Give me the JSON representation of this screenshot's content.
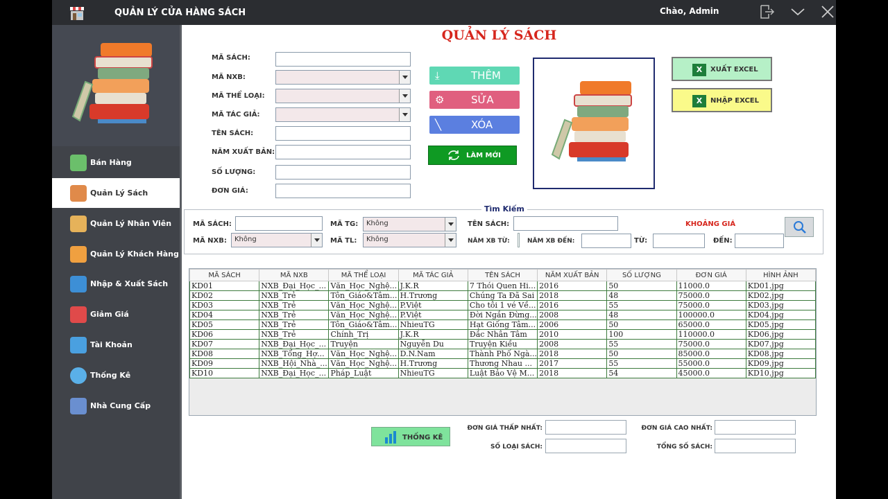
{
  "titlebar": {
    "title": "QUẢN LÝ CỬA HÀNG SÁCH",
    "greeting": "Chào,  Admin"
  },
  "sidebar": {
    "items": [
      {
        "label": "Bán Hàng",
        "icon": "cash-register-icon",
        "color": "#6bbf6b"
      },
      {
        "label": "Quản Lý Sách",
        "icon": "book-icon",
        "color": "#e08a4a"
      },
      {
        "label": "Quản Lý Nhân Viên",
        "icon": "people-icon",
        "color": "#e6b25a"
      },
      {
        "label": "Quản Lý Khách Hàng",
        "icon": "customer-icon",
        "color": "#f0a040"
      },
      {
        "label": "Nhập & Xuất Sách",
        "icon": "transfer-icon",
        "color": "#3d8fd6"
      },
      {
        "label": "Giảm Giá",
        "icon": "sale-icon",
        "color": "#e04a4a"
      },
      {
        "label": "Tài Khoản",
        "icon": "account-icon",
        "color": "#4aa0e0"
      },
      {
        "label": "Thống Kê",
        "icon": "pie-chart-icon",
        "color": "#5ab0e8"
      },
      {
        "label": "Nhà Cung Cấp",
        "icon": "store-icon",
        "color": "#6a8fd0"
      }
    ]
  },
  "heading": "QUẢN LÝ SÁCH",
  "form": {
    "ma_sach": "MÃ SÁCH:",
    "ma_nxb": "MÃ NXB:",
    "ma_the_loai": "MÃ THỂ LOẠI:",
    "ma_tac_gia": "MÃ TÁC GIẢ:",
    "ten_sach": "TÊN SÁCH:",
    "nam_xuat_ban": "NĂM XUẤT BẢN:",
    "so_luong": "SỐ LƯỢNG:",
    "don_gia": "ĐƠN GIÁ:"
  },
  "actions": {
    "them": "THÊM",
    "sua": "SỬA",
    "xoa": "XÓA",
    "lam_moi": "LÀM MỚI",
    "xuat_excel": "XUẤT EXCEL",
    "nhap_excel": "NHẬP EXCEL"
  },
  "search": {
    "title": "Tìm Kiếm",
    "ma_sach": "MÃ SÁCH:",
    "ma_tg": "MÃ TG:",
    "ten_sach": "TÊN SÁCH:",
    "ma_nxb": "MÃ NXB:",
    "ma_tl": "MÃ TL:",
    "nam_xb_tu": "NĂM XB TỪ:",
    "nam_xb_den": "NĂM XB ĐẾN:",
    "tu": "TỪ:",
    "den": "ĐẾN:",
    "khoang_gia": "KHOẢNG GIÁ",
    "ma_tg_value": "Không",
    "ma_nxb_value": "Không",
    "ma_tl_value": "Không"
  },
  "table": {
    "columns": [
      "MÃ SÁCH",
      "MÃ NXB",
      "MÃ THỂ LOẠI",
      "MÃ TÁC GIẢ",
      "TÊN SÁCH",
      "NĂM XUẤT BẢN",
      "SỐ LƯỢNG",
      "ĐƠN GIÁ",
      "HÌNH ẢNH"
    ],
    "rows": [
      [
        "KD01",
        "NXB_Đại_Học_...",
        "Văn_Học_Nghệ...",
        "J.K.R",
        "7 Thói Quen Hi...",
        "2016",
        "50",
        "11000.0",
        "KD01.jpg"
      ],
      [
        "KD02",
        "NXB_Trẻ",
        "Tôn_Giáo&Tâm...",
        "H.Trương",
        "Chúng Ta Đã Sai",
        "2018",
        "48",
        "75000.0",
        "KD02.jpg"
      ],
      [
        "KD03",
        "NXB_Trẻ",
        "Văn_Học_Nghệ...",
        "P.Việt",
        "Cho tôi 1 vé Về...",
        "2016",
        "55",
        "75000.0",
        "KD03.jpg"
      ],
      [
        "KD04",
        "NXB_Trẻ",
        "Văn_Học_Nghệ...",
        "P.Việt",
        "Đời Ngắn Đừng...",
        "2008",
        "48",
        "100000.0",
        "KD04.jpg"
      ],
      [
        "KD05",
        "NXB_Trẻ",
        "Tôn_Giáo&Tâm...",
        "NhieuTG",
        "Hạt Giống Tâm...",
        "2006",
        "50",
        "65000.0",
        "KD05.jpg"
      ],
      [
        "KD06",
        "NXB_Trẻ",
        "Chính_Trị",
        "J.K.R",
        "Đắc Nhân Tâm",
        "2010",
        "100",
        "110000.0",
        "KD06.jpg"
      ],
      [
        "KD07",
        "NXB_Đại_Học_...",
        "Truyện",
        "Nguyễn Du",
        "Truyện Kiều",
        "2008",
        "55",
        "75000.0",
        "KD07.jpg"
      ],
      [
        "KD08",
        "NXB_Tổng_Hợ...",
        "Văn_Học_Nghệ...",
        "D.N.Nam",
        "Thành Phố Ngà...",
        "2018",
        "50",
        "85000.0",
        "KD08.jpg"
      ],
      [
        "KD09",
        "NXB_Hội_Nhà_...",
        "Văn_Học_Nghệ...",
        "H.Trương",
        "Thương Nhau ...",
        "2017",
        "55",
        "55000.0",
        "KD09.jpg"
      ],
      [
        "KD10",
        "NXB_Đại_Học_...",
        "Pháp_Luật",
        "NhieuTG",
        "Luật Bảo Vệ M...",
        "2018",
        "54",
        "45000.0",
        "KD10.jpg"
      ]
    ]
  },
  "stats": {
    "button": "THỐNG KÊ",
    "min_price": "ĐƠN GIÁ THẤP NHẤT:",
    "max_price": "ĐƠN GIÁ CAO NHẤT:",
    "book_types": "SỐ LOẠI SÁCH:",
    "total_books": "TỔNG SỐ SÁCH:"
  }
}
